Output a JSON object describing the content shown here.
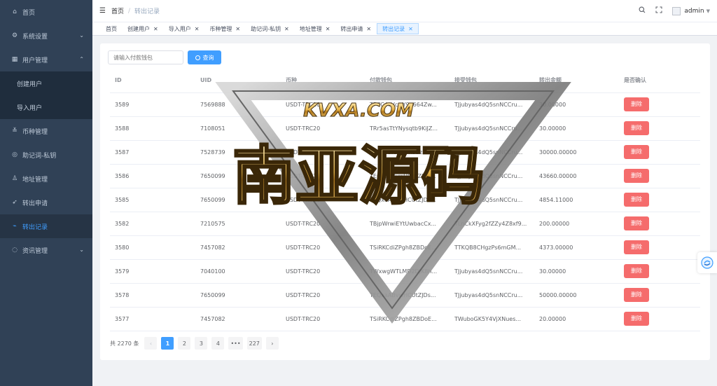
{
  "sidebar": {
    "items": [
      {
        "label": "首页",
        "icon": "dashboard-icon",
        "glyph": "⌂"
      },
      {
        "label": "系统设置",
        "icon": "settings-icon",
        "glyph": "⚙",
        "arrow": "⌄"
      },
      {
        "label": "用户管理",
        "icon": "user-management-icon",
        "glyph": "▦",
        "arrow": "⌃"
      },
      {
        "label": "创建用户",
        "sub": true
      },
      {
        "label": "导入用户",
        "sub": true
      },
      {
        "label": "币种管理",
        "icon": "currency-icon",
        "glyph": "≚"
      },
      {
        "label": "助记词-私钥",
        "icon": "key-icon",
        "glyph": "◎"
      },
      {
        "label": "地址管理",
        "icon": "address-icon",
        "glyph": "♙"
      },
      {
        "label": "转出申请",
        "icon": "rocket-icon",
        "glyph": "➶"
      },
      {
        "label": "转出记录",
        "icon": "record-icon",
        "glyph": "⌁",
        "active": true
      },
      {
        "label": "资讯管理",
        "icon": "news-icon",
        "glyph": "◌",
        "arrow": "⌄"
      }
    ]
  },
  "navbar": {
    "breadcrumb": [
      "首页",
      "转出记录"
    ],
    "separator": "/",
    "user": "admin"
  },
  "tags": [
    "首页",
    "创建用户",
    "导入用户",
    "币种管理",
    "助记词-私钥",
    "地址管理",
    "转出申请",
    "转出记录"
  ],
  "tag_close": "✕",
  "search": {
    "placeholder": "请输入付款钱包",
    "button": "查询"
  },
  "table": {
    "columns": [
      "ID",
      "UID",
      "币种",
      "付款钱包",
      "接受钱包",
      "转出金额",
      "是否确认"
    ],
    "rows": [
      {
        "id": "3589",
        "uid": "7569888",
        "coin": "USDT-TRC20",
        "from": "TPCC4cVcwY9o664Zw...",
        "to": "TJjubyas4dQ5snNCCru...",
        "amount": "30.00000",
        "action": "删除"
      },
      {
        "id": "3588",
        "uid": "7108051",
        "coin": "USDT-TRC20",
        "from": "TRr5asTtYNysqtb9KiJZ...",
        "to": "TJjubyas4dQ5snNCCru...",
        "amount": "30.00000",
        "action": "删除"
      },
      {
        "id": "3587",
        "uid": "7528739",
        "coin": "USDT-TRC20",
        "from": "TGF3p9rDv4JmSBziaC...",
        "to": "TJjubyas4dQ5snNCCru...",
        "amount": "30000.00000",
        "action": "删除"
      },
      {
        "id": "3586",
        "uid": "7650099",
        "coin": "USDT-TRC20",
        "from": "TEQxaABvwHCUtZJDs...",
        "to": "TJjubyas4dQ5snNCCru...",
        "amount": "43660.00000",
        "action": "删除"
      },
      {
        "id": "3585",
        "uid": "7650099",
        "coin": "USDT-TRC20",
        "from": "TEQxaABvwHCUtZJDs...",
        "to": "TJjubyas4dQ5snNCCru...",
        "amount": "4854.11000",
        "action": "删除"
      },
      {
        "id": "3582",
        "uid": "7210575",
        "coin": "USDT-TRC20",
        "from": "TBjpWrwiEYtUwbacCx...",
        "to": "TLnCkXFyg2fZZy4Z8xf9...",
        "amount": "200.00000",
        "action": "删除"
      },
      {
        "id": "3580",
        "uid": "7457082",
        "coin": "USDT-TRC20",
        "from": "TSiRKCdiZPgh8ZBDoE...",
        "to": "TTKQB8CHgzPs6mGM...",
        "amount": "4373.00000",
        "action": "删除"
      },
      {
        "id": "3579",
        "uid": "7040100",
        "coin": "USDT-TRC20",
        "from": "TWxwgWTLMD2DJK8h...",
        "to": "TJjubyas4dQ5snNCCru...",
        "amount": "30.00000",
        "action": "删除"
      },
      {
        "id": "3578",
        "uid": "7650099",
        "coin": "USDT-TRC20",
        "from": "TEQxaABvwHCUtZJDs...",
        "to": "TJjubyas4dQ5snNCCru...",
        "amount": "50000.00000",
        "action": "删除"
      },
      {
        "id": "3577",
        "uid": "7457082",
        "coin": "USDT-TRC20",
        "from": "TSiRKCdiZPgh8ZBDoE...",
        "to": "TWuboGK5Y4VjXNues...",
        "amount": "20.00000",
        "action": "删除"
      }
    ]
  },
  "pagination": {
    "total": "共 2270 条",
    "prev": "‹",
    "next": "›",
    "pages": [
      "1",
      "2",
      "3",
      "4",
      "•••",
      "227"
    ],
    "current": "1"
  },
  "watermark": {
    "text_top": "KVXA.COM",
    "text_main": "南亚源码"
  },
  "colors": {
    "sidebar_bg": "#304156",
    "primary": "#409eff",
    "danger": "#f56c6c"
  }
}
